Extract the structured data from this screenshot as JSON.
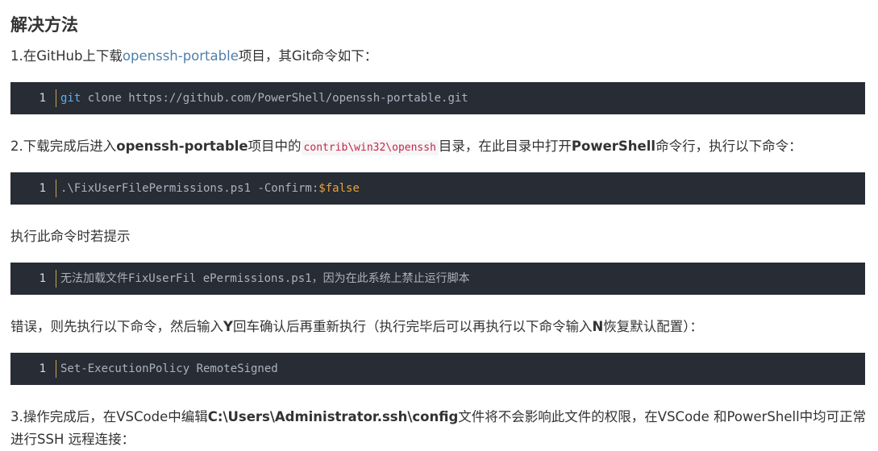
{
  "heading": "解决方法",
  "step1": {
    "prefix": "1.在GitHub上下载",
    "link": "openssh-portable",
    "suffix": "项目，其Git命令如下："
  },
  "code1": {
    "line_number": "1",
    "keyword": "git",
    "rest": " clone https://github.com/PowerShell/openssh-portable.git"
  },
  "step2": {
    "prefix": "2.下载完成后进入",
    "bold1": "openssh-portable",
    "mid1": "项目中的",
    "inline_code": "contrib\\win32\\openssh",
    "mid2": "目录，在此目录中打开",
    "bold2": "PowerShell",
    "suffix": "命令行，执行以下命令："
  },
  "code2": {
    "line_number": "1",
    "text": ".\\FixUserFilePermissions.ps1 -Confirm:",
    "variable": "$false"
  },
  "note1": "执行此命令时若提示",
  "code3": {
    "line_number": "1",
    "text": "无法加载文件FixUserFil ePermissions.ps1，因为在此系统上禁止运行脚本"
  },
  "note2": {
    "prefix": "错误，则先执行以下命令，然后输入",
    "bold1": "Y",
    "mid": "回车确认后再重新执行（执行完毕后可以再执行以下命令输入",
    "bold2": "N",
    "suffix": "恢复默认配置）："
  },
  "code4": {
    "line_number": "1",
    "text": "Set-ExecutionPolicy RemoteSigned"
  },
  "step3": {
    "prefix": "3.操作完成后，在VSCode中编辑",
    "bold": "C:\\Users\\Administrator.ssh\\config",
    "suffix": "文件将不会影响此文件的权限，在VSCode 和PowerShell中均可正常进行SSH 远程连接："
  }
}
